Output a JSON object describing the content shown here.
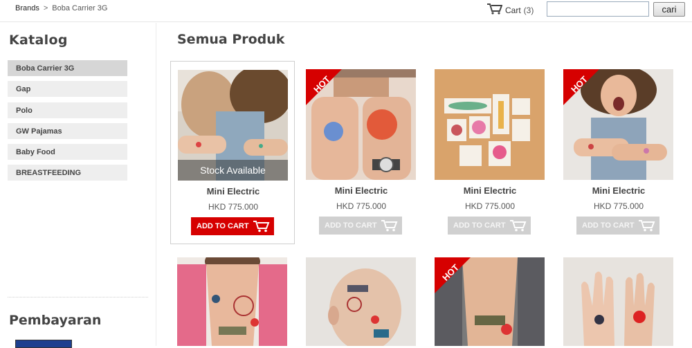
{
  "breadcrumb": {
    "root": "Brands",
    "separator": ">",
    "current": "Boba Carrier 3G"
  },
  "cart": {
    "label": "Cart",
    "count": "(3)"
  },
  "search": {
    "value": "",
    "placeholder": "",
    "button_label": "cari"
  },
  "sidebar": {
    "title": "Katalog",
    "items": [
      {
        "label": "Boba Carrier 3G",
        "active": true
      },
      {
        "label": "Gap",
        "active": false
      },
      {
        "label": "Polo",
        "active": false
      },
      {
        "label": "GW Pajamas",
        "active": false
      },
      {
        "label": "Baby Food",
        "active": false
      },
      {
        "label": "BREASTFEEDING",
        "active": false
      }
    ],
    "payment_title": "Pembayaran"
  },
  "main": {
    "title": "Semua Produk",
    "products": [
      {
        "name": "Mini Electric",
        "price": "HKD 775.000",
        "button": "ADD TO CART",
        "overlay": "Stock Available",
        "badge": "",
        "image": "girl-with-tattoos"
      },
      {
        "name": "Mini Electric",
        "price": "HKD 775.000",
        "button": "ADD TO CART",
        "badge": "HOT",
        "image": "fists-with-tattoos"
      },
      {
        "name": "Mini Electric",
        "price": "HKD 775.000",
        "button": "ADD TO CART",
        "badge": "",
        "image": "tattoo-sheets-on-wood"
      },
      {
        "name": "Mini Electric",
        "price": "HKD 775.000",
        "button": "ADD TO CART",
        "badge": "HOT",
        "image": "girl-crossed-arms"
      }
    ],
    "products_row2": [
      {
        "badge": "",
        "image": "chest-tattoos-pink-shirt"
      },
      {
        "badge": "",
        "image": "bald-head-tattoos"
      },
      {
        "badge": "HOT",
        "image": "chest-tattoos-plaid-shirt"
      },
      {
        "badge": "",
        "image": "palms-with-tattoos"
      }
    ]
  },
  "colors": {
    "accent_red": "#d60000",
    "button_gray": "#d0d0d0",
    "sidebar_active": "#d6d6d6"
  }
}
